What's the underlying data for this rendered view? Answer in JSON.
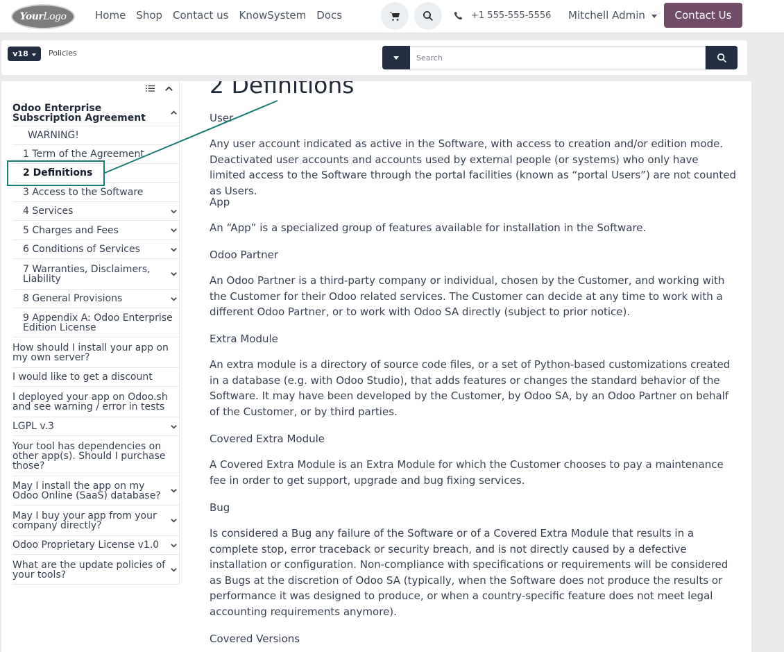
{
  "navbar": {
    "logo": {
      "part1": "Your",
      "part2": "Logo"
    },
    "links": [
      "Home",
      "Shop",
      "Contact us",
      "KnowSystem",
      "Docs"
    ],
    "phone": "+1 555-555-5556",
    "user": "Mitchell Admin",
    "contact_button": "Contact Us",
    "icons": {
      "cart": "cart-icon",
      "search": "search-icon",
      "phone": "phone-icon"
    }
  },
  "subbar": {
    "version": "v18",
    "breadcrumb": "Policies",
    "search_placeholder": "Search"
  },
  "sidebar": {
    "items": [
      {
        "label": "Odoo Enterprise Subscription Agreement",
        "chevron": "up"
      },
      {
        "label": "WARNING!"
      },
      {
        "label": "1 Term of the Agreement"
      },
      {
        "label": "2 Definitions",
        "active": true
      },
      {
        "label": "3 Access to the Software"
      },
      {
        "label": "4 Services",
        "chevron": "down"
      },
      {
        "label": "5 Charges and Fees",
        "chevron": "down"
      },
      {
        "label": "6 Conditions of Services",
        "chevron": "down"
      },
      {
        "label": "7 Warranties, Disclaimers, Liability",
        "chevron": "down"
      },
      {
        "label": "8 General Provisions",
        "chevron": "down"
      },
      {
        "label": "9 Appendix A: Odoo Enterprise Edition License"
      },
      {
        "label": "How should I install your app on my own server?"
      },
      {
        "label": "I would like to get a discount"
      },
      {
        "label": "I deployed your app on Odoo.sh and see warning / error in tests"
      },
      {
        "label": "LGPL v.3",
        "chevron": "down"
      },
      {
        "label": "Your tool has dependencies on other app(s). Should I purchase those?"
      },
      {
        "label": "May I install the app on my Odoo Online (SaaS) database?",
        "chevron": "down"
      },
      {
        "label": "May I buy your app from your company directly?",
        "chevron": "down"
      },
      {
        "label": "Odoo Proprietary License v1.0",
        "chevron": "down"
      },
      {
        "label": "What are the update policies of your tools?",
        "chevron": "down"
      }
    ]
  },
  "article": {
    "title": "2 Definitions",
    "entries": [
      {
        "term": "User",
        "definition": "Any user account indicated as active in the Software, with access to creation and/or edition mode. Deactivated user accounts and accounts used by external people (or systems) who only have limited access to the Software through the portal facilities (known as “portal Users”) are not counted as Users."
      },
      {
        "term": "App",
        "definition": "An “App” is a specialized group of features available for installation in the Software."
      },
      {
        "term": "Odoo Partner",
        "definition": "An Odoo Partner is a third-party company or individual, chosen by the Customer, and working with the Customer for their Odoo related services. The Customer can decide at any time to work with a different Odoo Partner, or to work with Odoo SA directly (subject to prior notice)."
      },
      {
        "term": "Extra Module",
        "definition": "An extra module is a directory of source code files, or a set of Python-based customizations created in a database (e.g. with Odoo Studio), that adds features or changes the standard behavior of the Software. It may have been developed by the Customer, by Odoo SA, by an Odoo Partner on behalf of the Customer, or by third parties."
      },
      {
        "term": "Covered Extra Module",
        "definition": "A Covered Extra Module is an Extra Module for which the Customer chooses to pay a maintenance fee in order to get support, upgrade and bug fixing services."
      },
      {
        "term": "Bug",
        "definition": "Is considered a Bug any failure of the Software or of a Covered Extra Module that results in a complete stop, error traceback or security breach, and is not directly caused by a defective installation or configuration. Non-compliance with specifications or requirements will be considered as Bugs at the discretion of Odoo SA (typically, when the Software does not produce the results or performance it was designed to produce, or when a country-specific feature does not meet legal accounting requirements anymore)."
      },
      {
        "term": "Covered Versions",
        "definition": ""
      }
    ]
  },
  "colors": {
    "primary": "#714b67",
    "dark": "#232e43",
    "annotation": "#177e74"
  }
}
